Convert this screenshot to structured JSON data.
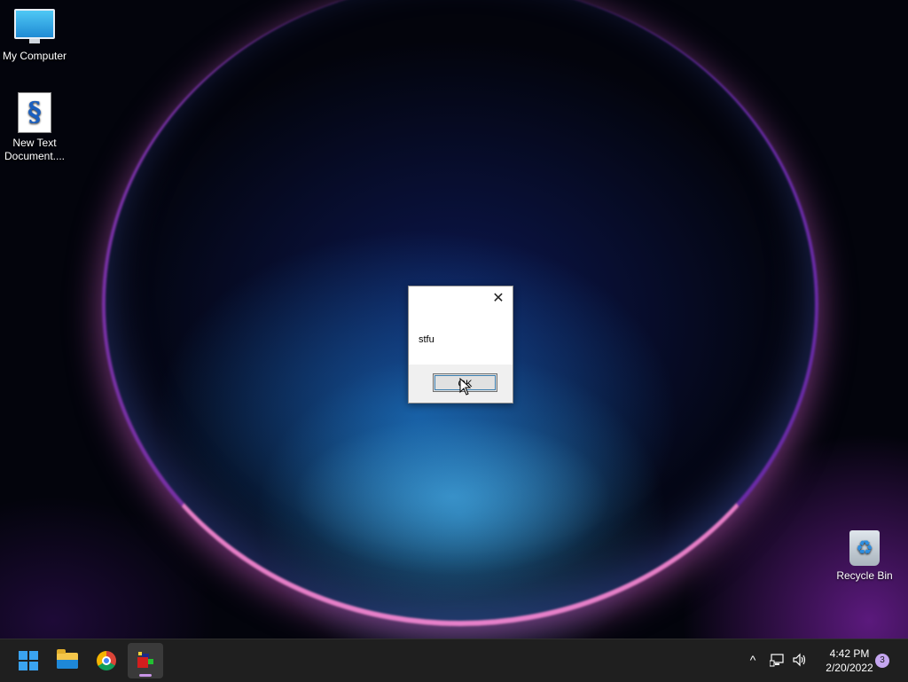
{
  "desktop": {
    "icons": [
      {
        "label": "My Computer",
        "icon": "monitor-icon"
      },
      {
        "label": "New Text Document....",
        "icon": "text-file-icon"
      },
      {
        "label": "Recycle Bin",
        "icon": "recycle-bin-icon"
      }
    ]
  },
  "dialog": {
    "message": "stfu",
    "ok_label": "OK",
    "close_glyph": "✕"
  },
  "taskbar": {
    "apps": [
      {
        "name": "Start",
        "icon": "windows-start-icon"
      },
      {
        "name": "File Explorer",
        "icon": "folder-icon"
      },
      {
        "name": "Google Chrome",
        "icon": "chrome-icon"
      },
      {
        "name": "Running app",
        "icon": "app-icon",
        "active": true
      }
    ],
    "tray": {
      "overflow_glyph": "^",
      "time": "4:42 PM",
      "date": "2/20/2022",
      "notification_count": "3"
    }
  },
  "colors": {
    "taskbar_bg": "#1f1f1f",
    "accent": "#3aa3f0",
    "badge": "#c5a6f0"
  }
}
